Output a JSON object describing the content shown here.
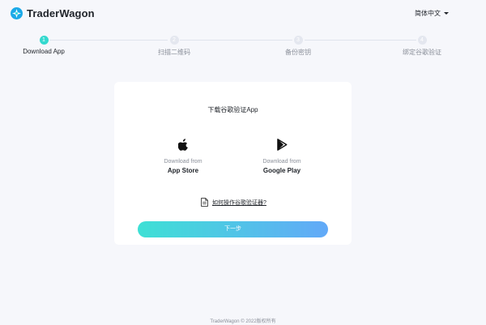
{
  "header": {
    "brand_name": "TraderWagon",
    "language": "简体中文",
    "brand_color": "#1aa9e8"
  },
  "steps": [
    {
      "number": "1",
      "label": "Download App",
      "active": true
    },
    {
      "number": "2",
      "label": "扫描二维码",
      "active": false
    },
    {
      "number": "3",
      "label": "备份密钥",
      "active": false
    },
    {
      "number": "4",
      "label": "绑定谷歌验证",
      "active": false
    }
  ],
  "card": {
    "title": "下载谷歌验证App",
    "downloads": [
      {
        "icon": "apple-icon",
        "from_label": "Download from",
        "store": "App Store"
      },
      {
        "icon": "google-play-icon",
        "from_label": "Download from",
        "store": "Google Play"
      }
    ],
    "howto_icon": "document-icon",
    "howto_label": "如何操作谷歌验证器?",
    "next_label": "下一步"
  },
  "footer": {
    "copyright": "TraderWagon © 2022版权所有"
  },
  "colors": {
    "accent": "#34d9cf",
    "gradient_start": "#3ee0d5",
    "gradient_end": "#62a9f8",
    "background": "#f6f7fb"
  }
}
